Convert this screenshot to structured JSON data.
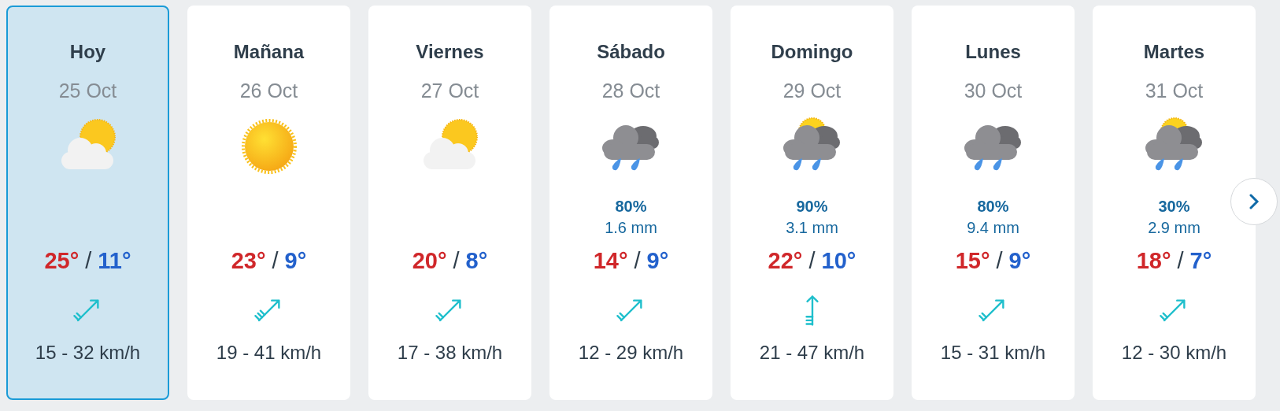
{
  "days": [
    {
      "name": "Hoy",
      "date": "25 Oct",
      "selected": true,
      "sky": {
        "kind": "sun-cloud"
      },
      "max": "25°",
      "separator": "/",
      "min": "11°",
      "wind_icon": {
        "kind": "ne-2"
      },
      "wind": "15 - 32 km/h"
    },
    {
      "name": "Mañana",
      "date": "26 Oct",
      "selected": false,
      "sky": {
        "kind": "sun"
      },
      "max": "23°",
      "separator": "/",
      "min": "9°",
      "wind_icon": {
        "kind": "ne-3"
      },
      "wind": "19 - 41 km/h"
    },
    {
      "name": "Viernes",
      "date": "27 Oct",
      "selected": false,
      "sky": {
        "kind": "sun-cloud"
      },
      "max": "20°",
      "separator": "/",
      "min": "8°",
      "wind_icon": {
        "kind": "ne-2"
      },
      "wind": "17 - 38 km/h"
    },
    {
      "name": "Sábado",
      "date": "28 Oct",
      "selected": false,
      "sky": {
        "kind": "rain"
      },
      "rain_chance": "80%",
      "rain_amount": "1.6 mm",
      "max": "14°",
      "separator": "/",
      "min": "9°",
      "wind_icon": {
        "kind": "ne-2"
      },
      "wind": "12 - 29 km/h"
    },
    {
      "name": "Domingo",
      "date": "29 Oct",
      "selected": false,
      "sky": {
        "kind": "sun-rain"
      },
      "rain_chance": "90%",
      "rain_amount": "3.1 mm",
      "max": "22°",
      "separator": "/",
      "min": "10°",
      "wind_icon": {
        "kind": "n-3"
      },
      "wind": "21 - 47 km/h"
    },
    {
      "name": "Lunes",
      "date": "30 Oct",
      "selected": false,
      "sky": {
        "kind": "rain"
      },
      "rain_chance": "80%",
      "rain_amount": "9.4 mm",
      "max": "15°",
      "separator": "/",
      "min": "9°",
      "wind_icon": {
        "kind": "ne-2"
      },
      "wind": "15 - 31 km/h"
    },
    {
      "name": "Martes",
      "date": "31 Oct",
      "selected": false,
      "sky": {
        "kind": "sun-rain"
      },
      "rain_chance": "30%",
      "rain_amount": "2.9 mm",
      "max": "18°",
      "separator": "/",
      "min": "7°",
      "wind_icon": {
        "kind": "ne-2"
      },
      "wind": "12 - 30 km/h"
    }
  ],
  "next_button": {
    "kind": "chevron"
  }
}
